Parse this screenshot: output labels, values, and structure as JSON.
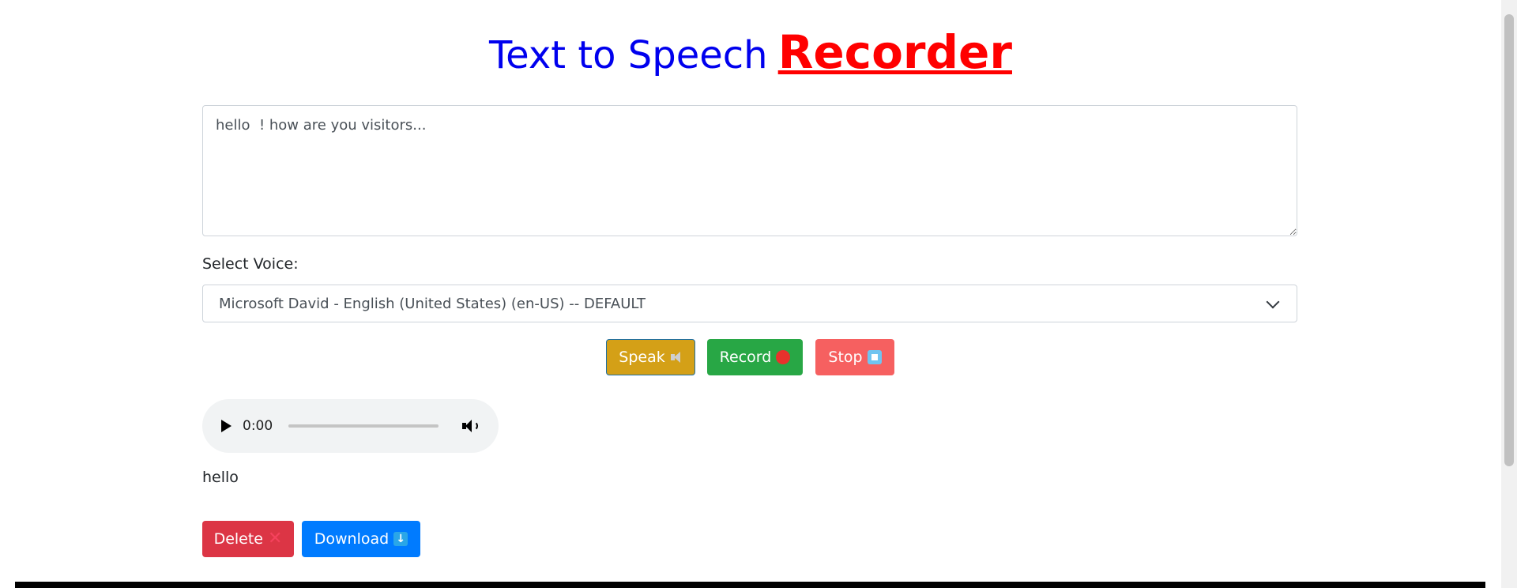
{
  "header": {
    "title_main": "Text to Speech",
    "title_accent": "Recorder"
  },
  "editor": {
    "text": "hello  ! how are you visitors..."
  },
  "voice": {
    "label": "Select Voice:",
    "selected": "Microsoft David - English (United States) (en-US) -- DEFAULT"
  },
  "controls": {
    "speak_label": "Speak",
    "record_label": "Record",
    "stop_label": "Stop"
  },
  "player": {
    "time": "0:00"
  },
  "recording": {
    "text": "hello",
    "delete_label": "Delete",
    "download_label": "Download"
  },
  "icons": {
    "speak": "speaker-icon",
    "record": "record-dot-icon",
    "stop": "stop-square-icon",
    "delete": "cross-icon",
    "download": "download-arrow-icon"
  },
  "colors": {
    "title_main": "#0000ee",
    "title_accent": "#ff0000",
    "speak": "#d4a017",
    "record": "#28a745",
    "stop": "#f66060",
    "delete": "#dc3545",
    "download": "#007bff"
  }
}
